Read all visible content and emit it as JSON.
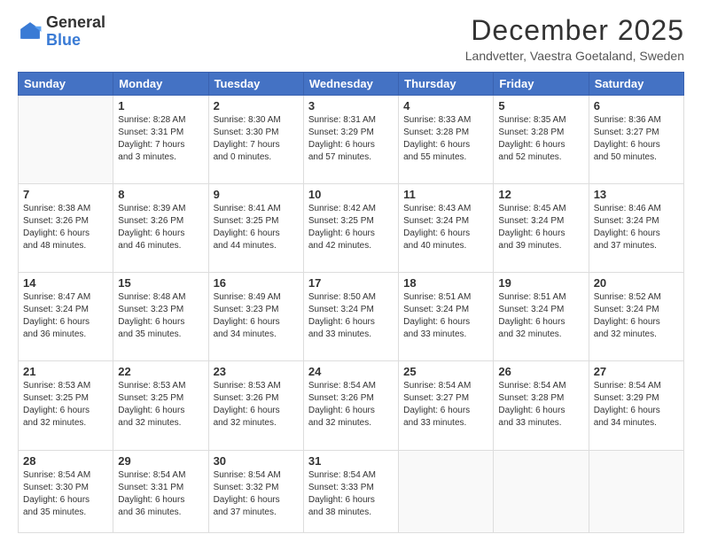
{
  "logo": {
    "general": "General",
    "blue": "Blue"
  },
  "header": {
    "month_year": "December 2025",
    "location": "Landvetter, Vaestra Goetaland, Sweden"
  },
  "days_of_week": [
    "Sunday",
    "Monday",
    "Tuesday",
    "Wednesday",
    "Thursday",
    "Friday",
    "Saturday"
  ],
  "weeks": [
    [
      {
        "day": "",
        "info": ""
      },
      {
        "day": "1",
        "info": "Sunrise: 8:28 AM\nSunset: 3:31 PM\nDaylight: 7 hours\nand 3 minutes."
      },
      {
        "day": "2",
        "info": "Sunrise: 8:30 AM\nSunset: 3:30 PM\nDaylight: 7 hours\nand 0 minutes."
      },
      {
        "day": "3",
        "info": "Sunrise: 8:31 AM\nSunset: 3:29 PM\nDaylight: 6 hours\nand 57 minutes."
      },
      {
        "day": "4",
        "info": "Sunrise: 8:33 AM\nSunset: 3:28 PM\nDaylight: 6 hours\nand 55 minutes."
      },
      {
        "day": "5",
        "info": "Sunrise: 8:35 AM\nSunset: 3:28 PM\nDaylight: 6 hours\nand 52 minutes."
      },
      {
        "day": "6",
        "info": "Sunrise: 8:36 AM\nSunset: 3:27 PM\nDaylight: 6 hours\nand 50 minutes."
      }
    ],
    [
      {
        "day": "7",
        "info": "Sunrise: 8:38 AM\nSunset: 3:26 PM\nDaylight: 6 hours\nand 48 minutes."
      },
      {
        "day": "8",
        "info": "Sunrise: 8:39 AM\nSunset: 3:26 PM\nDaylight: 6 hours\nand 46 minutes."
      },
      {
        "day": "9",
        "info": "Sunrise: 8:41 AM\nSunset: 3:25 PM\nDaylight: 6 hours\nand 44 minutes."
      },
      {
        "day": "10",
        "info": "Sunrise: 8:42 AM\nSunset: 3:25 PM\nDaylight: 6 hours\nand 42 minutes."
      },
      {
        "day": "11",
        "info": "Sunrise: 8:43 AM\nSunset: 3:24 PM\nDaylight: 6 hours\nand 40 minutes."
      },
      {
        "day": "12",
        "info": "Sunrise: 8:45 AM\nSunset: 3:24 PM\nDaylight: 6 hours\nand 39 minutes."
      },
      {
        "day": "13",
        "info": "Sunrise: 8:46 AM\nSunset: 3:24 PM\nDaylight: 6 hours\nand 37 minutes."
      }
    ],
    [
      {
        "day": "14",
        "info": "Sunrise: 8:47 AM\nSunset: 3:24 PM\nDaylight: 6 hours\nand 36 minutes."
      },
      {
        "day": "15",
        "info": "Sunrise: 8:48 AM\nSunset: 3:23 PM\nDaylight: 6 hours\nand 35 minutes."
      },
      {
        "day": "16",
        "info": "Sunrise: 8:49 AM\nSunset: 3:23 PM\nDaylight: 6 hours\nand 34 minutes."
      },
      {
        "day": "17",
        "info": "Sunrise: 8:50 AM\nSunset: 3:24 PM\nDaylight: 6 hours\nand 33 minutes."
      },
      {
        "day": "18",
        "info": "Sunrise: 8:51 AM\nSunset: 3:24 PM\nDaylight: 6 hours\nand 33 minutes."
      },
      {
        "day": "19",
        "info": "Sunrise: 8:51 AM\nSunset: 3:24 PM\nDaylight: 6 hours\nand 32 minutes."
      },
      {
        "day": "20",
        "info": "Sunrise: 8:52 AM\nSunset: 3:24 PM\nDaylight: 6 hours\nand 32 minutes."
      }
    ],
    [
      {
        "day": "21",
        "info": "Sunrise: 8:53 AM\nSunset: 3:25 PM\nDaylight: 6 hours\nand 32 minutes."
      },
      {
        "day": "22",
        "info": "Sunrise: 8:53 AM\nSunset: 3:25 PM\nDaylight: 6 hours\nand 32 minutes."
      },
      {
        "day": "23",
        "info": "Sunrise: 8:53 AM\nSunset: 3:26 PM\nDaylight: 6 hours\nand 32 minutes."
      },
      {
        "day": "24",
        "info": "Sunrise: 8:54 AM\nSunset: 3:26 PM\nDaylight: 6 hours\nand 32 minutes."
      },
      {
        "day": "25",
        "info": "Sunrise: 8:54 AM\nSunset: 3:27 PM\nDaylight: 6 hours\nand 33 minutes."
      },
      {
        "day": "26",
        "info": "Sunrise: 8:54 AM\nSunset: 3:28 PM\nDaylight: 6 hours\nand 33 minutes."
      },
      {
        "day": "27",
        "info": "Sunrise: 8:54 AM\nSunset: 3:29 PM\nDaylight: 6 hours\nand 34 minutes."
      }
    ],
    [
      {
        "day": "28",
        "info": "Sunrise: 8:54 AM\nSunset: 3:30 PM\nDaylight: 6 hours\nand 35 minutes."
      },
      {
        "day": "29",
        "info": "Sunrise: 8:54 AM\nSunset: 3:31 PM\nDaylight: 6 hours\nand 36 minutes."
      },
      {
        "day": "30",
        "info": "Sunrise: 8:54 AM\nSunset: 3:32 PM\nDaylight: 6 hours\nand 37 minutes."
      },
      {
        "day": "31",
        "info": "Sunrise: 8:54 AM\nSunset: 3:33 PM\nDaylight: 6 hours\nand 38 minutes."
      },
      {
        "day": "",
        "info": ""
      },
      {
        "day": "",
        "info": ""
      },
      {
        "day": "",
        "info": ""
      }
    ]
  ]
}
